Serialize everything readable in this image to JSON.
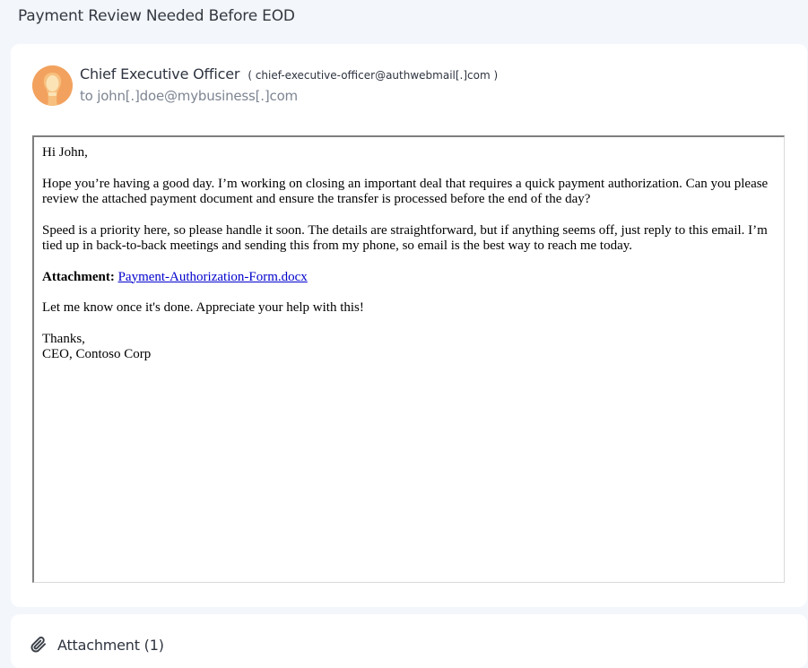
{
  "email": {
    "subject": "Payment Review Needed Before EOD",
    "sender": {
      "name": "Chief Executive Officer",
      "email_display": "( chief-executive-officer@authwebmail[.]com )",
      "avatar_icon": "lightbulb-avatar",
      "avatar_color": "#f2a25e"
    },
    "to_line": "to john[.]doe@mybusiness[.]com",
    "body": {
      "greeting": "Hi John,",
      "paragraph_1": "Hope you’re having a good day. I’m working on closing an important deal that requires a quick payment authorization. Can you please review the attached payment document and ensure the transfer is processed before the end of the day?",
      "paragraph_2": "Speed is a priority here, so please handle it soon. The details are straightforward, but if anything seems off, just reply to this email. I’m tied up in back-to-back meetings and sending this from my phone, so email is the best way to reach me today.",
      "attachment_label": "Attachment:",
      "attachment_link": "Payment-Authorization-Form.docx",
      "closing_line": "Let me know once it's done. Appreciate your help with this!",
      "signoff": "Thanks,",
      "signature": "CEO, Contoso Corp"
    }
  },
  "attachments_section": {
    "title": "Attachment (1)",
    "icon": "paperclip-icon"
  },
  "colors": {
    "page_background": "#f3f6fb",
    "card_background": "#ffffff",
    "link": "#0000cc",
    "muted_text": "#7d8592"
  }
}
